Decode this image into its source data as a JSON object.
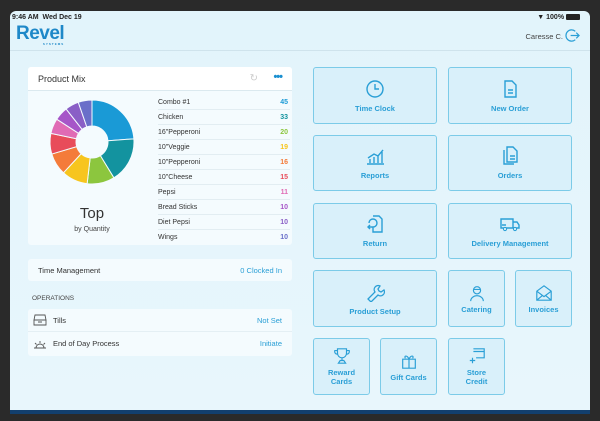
{
  "status": {
    "time": "9:46 AM",
    "date": "Wed Dec 19",
    "battery": "100%"
  },
  "header": {
    "logo": "Revel",
    "logo_sub": "SYSTEMS",
    "user": "Caresse C."
  },
  "product_mix": {
    "title": "Product Mix",
    "center_label": "Top",
    "center_sub": "by Quantity",
    "items": [
      {
        "name": "Combo #1",
        "value": 45,
        "color": "#1a9ad6"
      },
      {
        "name": "Chicken",
        "value": 33,
        "color": "#13939f"
      },
      {
        "name": "16\"Pepperoni",
        "value": 20,
        "color": "#8cc63e"
      },
      {
        "name": "10\"Veggie",
        "value": 19,
        "color": "#f7c51e"
      },
      {
        "name": "10\"Pepperoni",
        "value": 16,
        "color": "#f47b3a"
      },
      {
        "name": "10\"Cheese",
        "value": 15,
        "color": "#e84c5a"
      },
      {
        "name": "Pepsi",
        "value": 11,
        "color": "#e06bb5"
      },
      {
        "name": "Bread Sticks",
        "value": 10,
        "color": "#a655c8"
      },
      {
        "name": "Diet Pepsi",
        "value": 10,
        "color": "#8a5fc6"
      },
      {
        "name": "Wings",
        "value": 10,
        "color": "#6a6fc9"
      }
    ]
  },
  "time_management": {
    "label": "Time Management",
    "value": "0 Clocked In"
  },
  "operations": {
    "heading": "OPERATIONS",
    "rows": [
      {
        "label": "Tills",
        "value": "Not Set"
      },
      {
        "label": "End of Day Process",
        "value": "Initiate"
      }
    ]
  },
  "tiles": {
    "time_clock": "Time Clock",
    "new_order": "New Order",
    "reports": "Reports",
    "orders": "Orders",
    "return": "Return",
    "delivery": "Delivery Management",
    "product_setup": "Product Setup",
    "catering": "Catering",
    "invoices": "Invoices",
    "reward_1": "Reward",
    "reward_2": "Cards",
    "gift_cards": "Gift Cards",
    "store_1": "Store",
    "store_2": "Credit"
  },
  "colors": {
    "accent": "#2a9fd6",
    "tile_border": "#7ccbe8"
  }
}
